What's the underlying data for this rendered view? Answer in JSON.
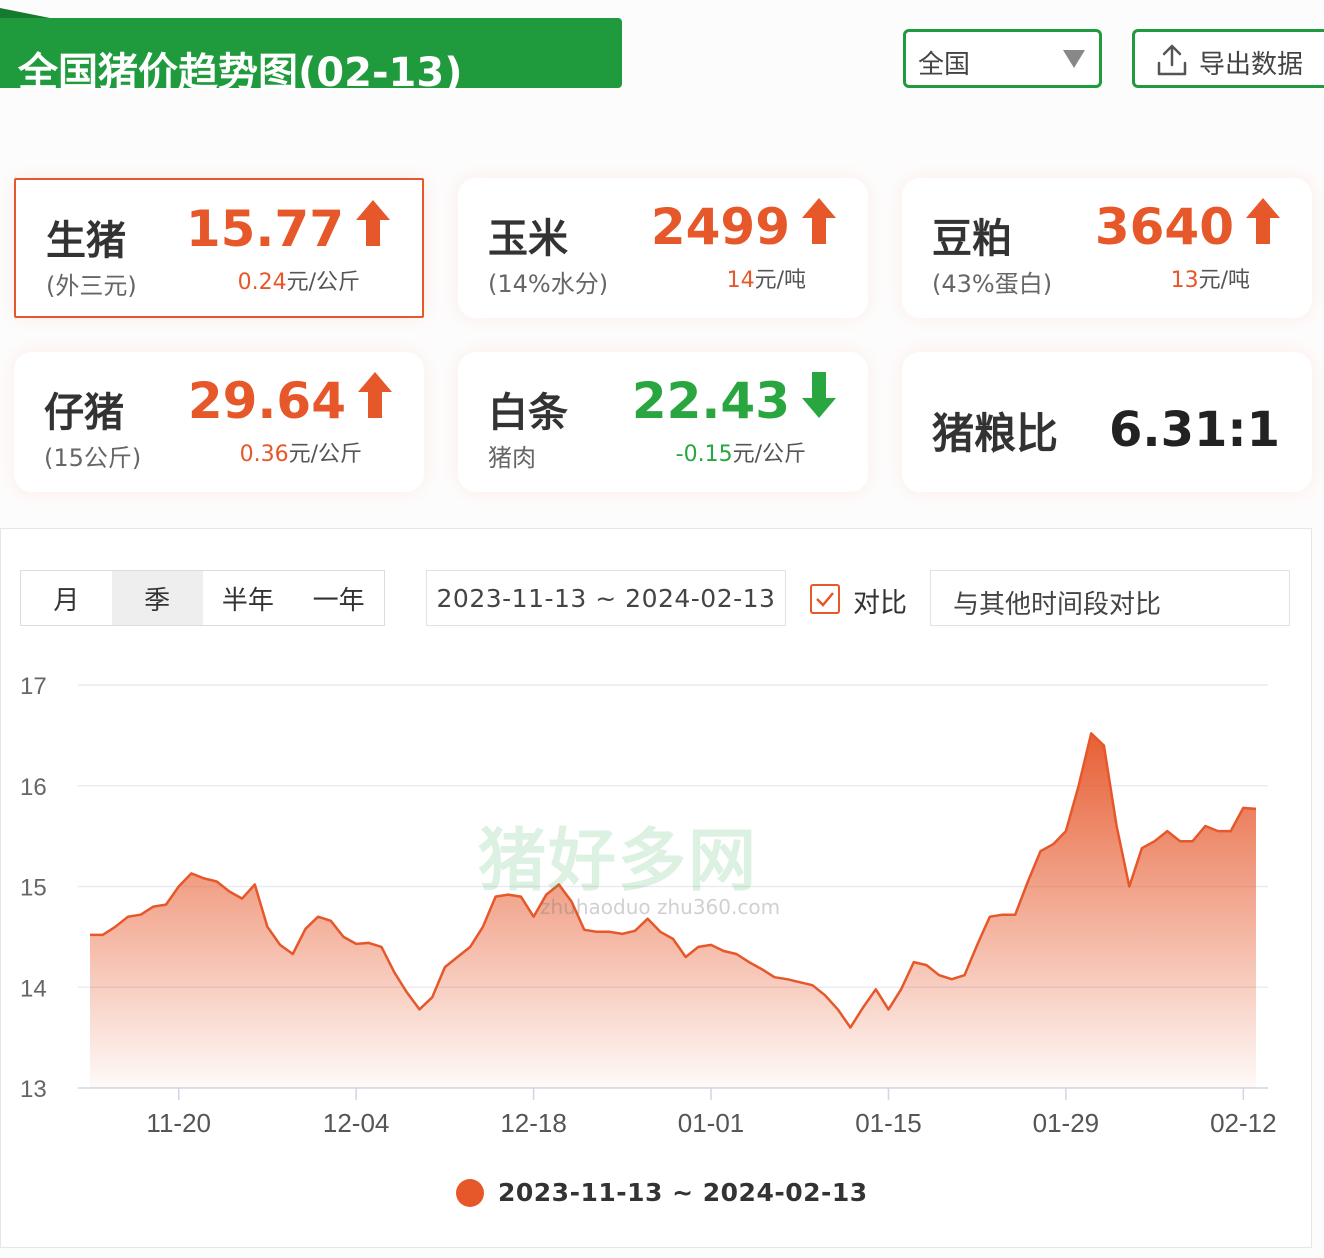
{
  "header": {
    "title": "全国猪价趋势图(02-13)",
    "region": "全国",
    "export_label": "导出数据"
  },
  "cards": [
    {
      "name": "生猪",
      "sub": "(外三元)",
      "price": "15.77",
      "dir": "up",
      "change": "0.24",
      "unit": "元/公斤"
    },
    {
      "name": "玉米",
      "sub": "(14%水分)",
      "price": "2499",
      "dir": "up",
      "change": "14",
      "unit": "元/吨"
    },
    {
      "name": "豆粕",
      "sub": "(43%蛋白)",
      "price": "3640",
      "dir": "up",
      "change": "13",
      "unit": "元/吨"
    },
    {
      "name": "仔猪",
      "sub": "(15公斤)",
      "price": "29.64",
      "dir": "up",
      "change": "0.36",
      "unit": "元/公斤"
    },
    {
      "name": "白条",
      "sub": "猪肉",
      "price": "22.43",
      "dir": "down",
      "change": "-0.15",
      "unit": "元/公斤"
    }
  ],
  "ratio": {
    "name": "猪粮比",
    "value": "6.31:1"
  },
  "controls": {
    "tabs": [
      "月",
      "季",
      "半年",
      "一年"
    ],
    "date_range": "2023-11-13 ~ 2024-02-13",
    "compare_label": "对比",
    "compare_placeholder": "与其他时间段对比"
  },
  "watermark": {
    "main": "猪好多网",
    "sub": "zhuhaoduo zhu360.com"
  },
  "colors": {
    "brand_green": "#1f9a3c",
    "up": "#e6572a",
    "down": "#2aa640"
  },
  "chart_data": {
    "type": "area",
    "title": "",
    "xlabel": "",
    "ylabel": "",
    "ylim": [
      13,
      17
    ],
    "yticks": [
      13,
      14,
      15,
      16,
      17
    ],
    "xticks": [
      "11-20",
      "12-04",
      "12-18",
      "01-01",
      "01-15",
      "01-29",
      "02-12"
    ],
    "grid": true,
    "legend": "bottom-center",
    "series": [
      {
        "name": "2023-11-13 ~ 2024-02-13",
        "color": "#e6572a",
        "x": [
          "11-13",
          "11-14",
          "11-15",
          "11-16",
          "11-17",
          "11-18",
          "11-19",
          "11-20",
          "11-21",
          "11-22",
          "11-23",
          "11-24",
          "11-25",
          "11-26",
          "11-27",
          "11-28",
          "11-29",
          "11-30",
          "12-01",
          "12-02",
          "12-03",
          "12-04",
          "12-05",
          "12-06",
          "12-07",
          "12-08",
          "12-09",
          "12-10",
          "12-11",
          "12-12",
          "12-13",
          "12-14",
          "12-15",
          "12-16",
          "12-17",
          "12-18",
          "12-19",
          "12-20",
          "12-21",
          "12-22",
          "12-23",
          "12-24",
          "12-25",
          "12-26",
          "12-27",
          "12-28",
          "12-29",
          "12-30",
          "12-31",
          "01-01",
          "01-02",
          "01-03",
          "01-04",
          "01-05",
          "01-06",
          "01-07",
          "01-08",
          "01-09",
          "01-10",
          "01-11",
          "01-12",
          "01-13",
          "01-14",
          "01-15",
          "01-16",
          "01-17",
          "01-18",
          "01-19",
          "01-20",
          "01-21",
          "01-22",
          "01-23",
          "01-24",
          "01-25",
          "01-26",
          "01-27",
          "01-28",
          "01-29",
          "01-30",
          "01-31",
          "02-01",
          "02-02",
          "02-03",
          "02-04",
          "02-05",
          "02-06",
          "02-07",
          "02-08",
          "02-09",
          "02-10",
          "02-11",
          "02-12",
          "02-13"
        ],
        "values": [
          14.52,
          14.52,
          14.6,
          14.7,
          14.72,
          14.8,
          14.82,
          15.0,
          15.13,
          15.08,
          15.05,
          14.95,
          14.88,
          15.02,
          14.6,
          14.42,
          14.33,
          14.58,
          14.7,
          14.66,
          14.5,
          14.43,
          14.44,
          14.4,
          14.15,
          13.95,
          13.78,
          13.9,
          14.2,
          14.3,
          14.4,
          14.6,
          14.9,
          14.92,
          14.9,
          14.7,
          14.92,
          15.02,
          14.85,
          14.57,
          14.55,
          14.55,
          14.53,
          14.56,
          14.68,
          14.55,
          14.48,
          14.3,
          14.4,
          14.42,
          14.36,
          14.33,
          14.25,
          14.18,
          14.1,
          14.08,
          14.05,
          14.02,
          13.92,
          13.78,
          13.6,
          13.8,
          13.98,
          13.78,
          13.98,
          14.25,
          14.22,
          14.12,
          14.08,
          14.12,
          14.42,
          14.7,
          14.72,
          14.72,
          15.05,
          15.35,
          15.42,
          15.55,
          16.0,
          16.52,
          16.4,
          15.6,
          15.0,
          15.38,
          15.45,
          15.55,
          15.45,
          15.45,
          15.6,
          15.55,
          15.55,
          15.78,
          15.77
        ]
      }
    ]
  }
}
